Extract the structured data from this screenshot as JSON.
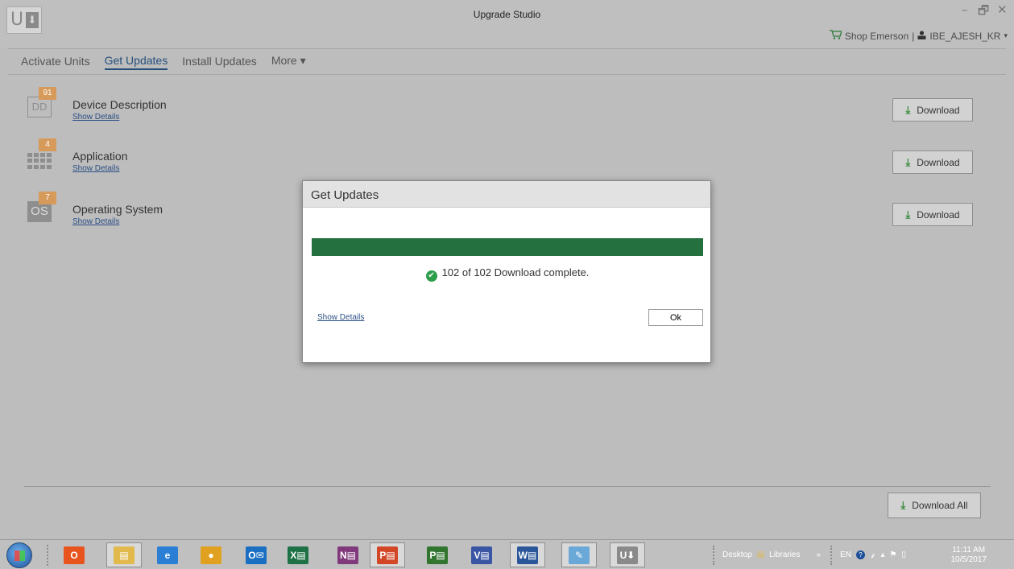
{
  "window": {
    "title": "Upgrade Studio",
    "logo_letter": "U",
    "logo_arrow": "⬇",
    "controls": {
      "minimize": "–",
      "restore": "🗗",
      "close": "✕"
    }
  },
  "user_bar": {
    "shop_label": "Shop Emerson",
    "separator": "|",
    "user_name": "IBE_AJESH_KR",
    "caret": "▾"
  },
  "nav": {
    "items": [
      {
        "label": "Activate Units",
        "active": false
      },
      {
        "label": "Get Updates",
        "active": true
      },
      {
        "label": "Install Updates",
        "active": false
      },
      {
        "label": "More ▾",
        "active": false
      }
    ]
  },
  "updates": [
    {
      "icon": "device-description-icon",
      "tile_text": "DD",
      "badge": "91",
      "title": "Device Description",
      "details_link": "Show Details",
      "button": "Download"
    },
    {
      "icon": "application-icon",
      "tile_text": "",
      "badge": "4",
      "title": "Application",
      "details_link": "Show Details",
      "button": "Download"
    },
    {
      "icon": "operating-system-icon",
      "tile_text": "OS",
      "badge": "7",
      "title": "Operating System",
      "details_link": "Show Details",
      "button": "Download"
    }
  ],
  "download_all": {
    "label": "Download All"
  },
  "modal": {
    "title": "Get Updates",
    "progress_fraction": 1.0,
    "status": "102 of 102 Download complete.",
    "details_link": "Show Details",
    "ok_label": "Ok"
  },
  "taskbar": {
    "apps": [
      {
        "name": "office-icon",
        "glyph": "O",
        "color": "#e8541e",
        "boxed": false
      },
      {
        "name": "file-explorer-icon",
        "glyph": "▤",
        "color": "#e2b94c",
        "boxed": true
      },
      {
        "name": "internet-explorer-icon",
        "glyph": "e",
        "color": "#2a7fd4",
        "boxed": false
      },
      {
        "name": "chrome-icon",
        "glyph": "●",
        "color": "#e0a020",
        "boxed": false
      },
      {
        "name": "outlook-icon",
        "glyph": "O✉",
        "color": "#1a6fc2",
        "boxed": false
      },
      {
        "name": "excel-icon",
        "glyph": "X▤",
        "color": "#1e7145",
        "boxed": false
      },
      {
        "name": "onenote-icon",
        "glyph": "N▤",
        "color": "#80397b",
        "boxed": false
      },
      {
        "name": "powerpoint-icon",
        "glyph": "P▤",
        "color": "#d24726",
        "boxed": true
      },
      {
        "name": "project-icon",
        "glyph": "P▤",
        "color": "#31752f",
        "boxed": false
      },
      {
        "name": "visio-icon",
        "glyph": "V▤",
        "color": "#3955a3",
        "boxed": false
      },
      {
        "name": "word-icon",
        "glyph": "W▤",
        "color": "#2b579a",
        "boxed": true
      },
      {
        "name": "paint-icon",
        "glyph": "✎",
        "color": "#6aa8d8",
        "boxed": true
      },
      {
        "name": "upgrade-studio-taskbar-icon",
        "glyph": "U⬇",
        "color": "#8a8a8a",
        "boxed": true
      }
    ],
    "tray": {
      "desktop": "Desktop",
      "libraries": "Libraries",
      "more": "»",
      "lang": "EN",
      "clock_time": "11:11 AM",
      "clock_date": "10/5/2017"
    }
  },
  "colors": {
    "accent_nav": "#254f7a",
    "progress": "#25703f",
    "download_icon": "#3b8c3f",
    "badge": "#d69b5a"
  }
}
